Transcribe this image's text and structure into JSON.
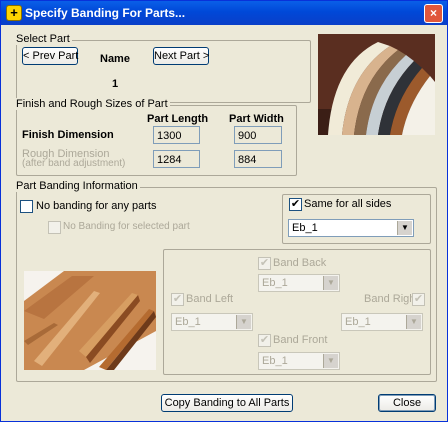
{
  "window": {
    "title": "Specify Banding For Parts...",
    "close_symbol": "×"
  },
  "select_part": {
    "group_label": "Select Part",
    "prev_label": "< Prev Part",
    "next_label": "Next Part >",
    "name_header": "Name",
    "part_number": "1"
  },
  "sizes": {
    "group_label": "Finish and Rough Sizes of Part",
    "length_header": "Part Length",
    "width_header": "Part Width",
    "finish_label": "Finish Dimension",
    "rough_label_line1": "Rough Dimension",
    "rough_label_line2": "(after band adjustment)",
    "finish_length": "1300",
    "finish_width": "900",
    "rough_length": "1284",
    "rough_width": "884"
  },
  "banding": {
    "group_label": "Part Banding Information",
    "no_banding_label": "No banding for any parts",
    "no_banding_selected_label": "No Banding for selected part",
    "same_all_sides_label": "Same for all sides",
    "check_mark": "✔",
    "all_sides_value": "Eb_1",
    "band_back_label": "Band Back",
    "band_left_label": "Band Left",
    "band_right_label": "Band Right",
    "band_front_label": "Band Front",
    "band_back_value": "Eb_1",
    "band_left_value": "Eb_1",
    "band_right_value": "Eb_1",
    "band_front_value": "Eb_1",
    "arrow": "▼"
  },
  "footer": {
    "copy_label": "Copy Banding to All Parts",
    "close_label": "Close"
  },
  "colors": {
    "title_bar": "#0a5fe8",
    "window_bg": "#ece9d8",
    "group_border": "#aca899"
  }
}
